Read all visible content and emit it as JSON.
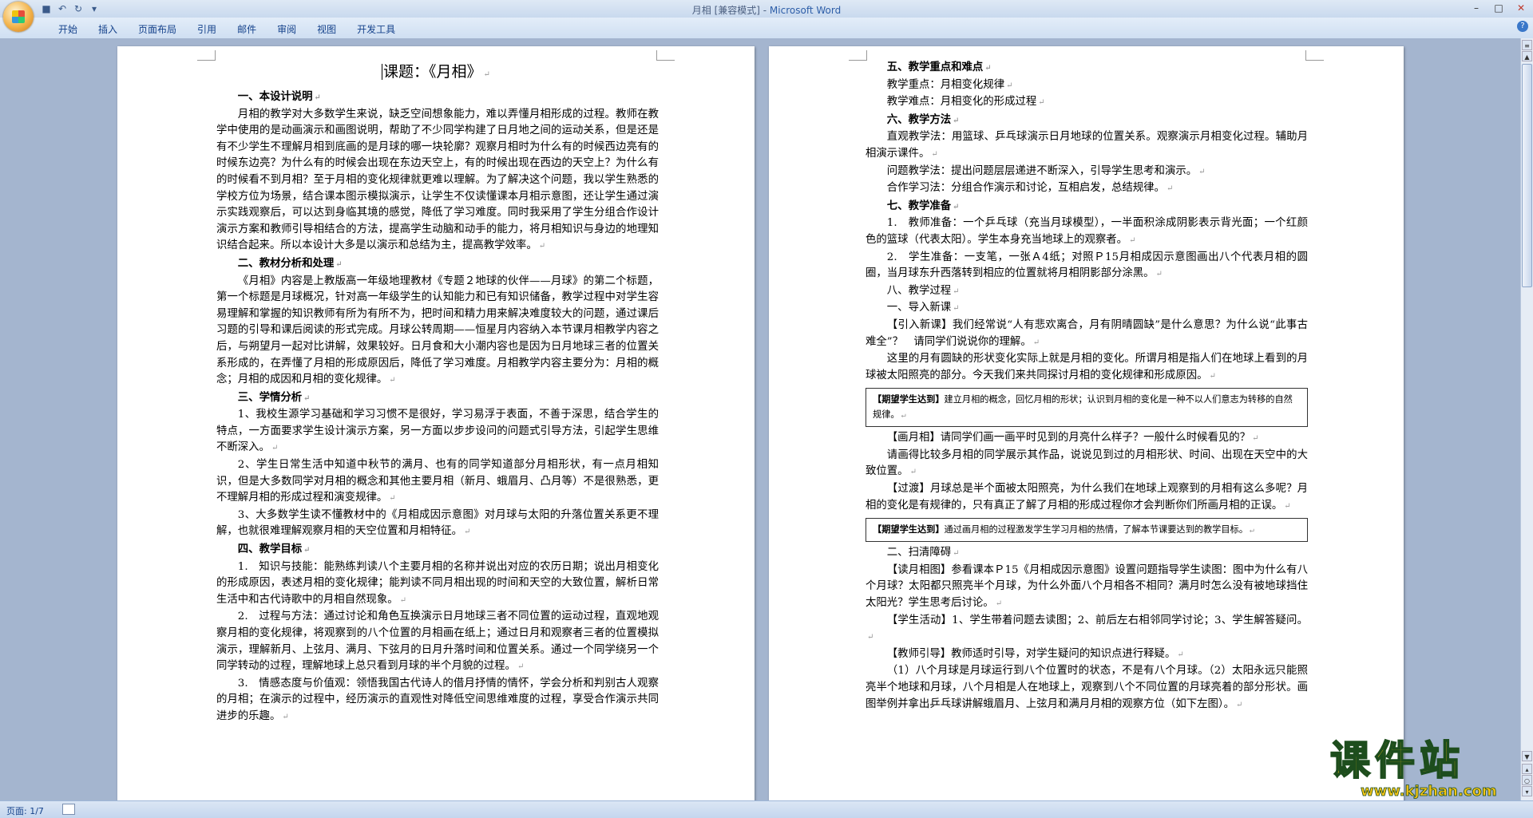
{
  "window": {
    "title_doc": "月相 [兼容模式] - ",
    "title_app": "Microsoft Word",
    "qat": [
      "save-icon",
      "undo-icon",
      "redo-icon",
      "customize-icon"
    ],
    "controls": [
      "–",
      "□",
      "✕"
    ]
  },
  "ribbon": {
    "tabs": [
      "开始",
      "插入",
      "页面布局",
      "引用",
      "邮件",
      "审阅",
      "视图",
      "开发工具"
    ],
    "help": "?"
  },
  "page1": {
    "title": "课题：《月相》",
    "s1_heading": "一、本设计说明",
    "s1_p1": "月相的教学对大多数学生来说，缺乏空间想象能力，难以弄懂月相形成的过程。教师在教学中使用的是动画演示和画图说明，帮助了不少同学构建了日月地之间的运动关系，但是还是有不少学生不理解月相到底画的是月球的哪一块轮廓？观察月相时为什么有的时候西边亮有的时候东边亮？为什么有的时候会出现在东边天空上，有的时候出现在西边的天空上？为什么有的时候看不到月相？至于月相的变化规律就更难以理解。为了解决这个问题，我以学生熟悉的学校方位为场景，结合课本图示模拟演示，让学生不仅读懂课本月相示意图，还让学生通过演示实践观察后，可以达到身临其境的感觉，降低了学习难度。同时我采用了学生分组合作设计演示方案和教师引导相结合的方法，提高学生动脑和动手的能力，将月相知识与身边的地理知识结合起来。所以本设计大多是以演示和总结为主，提高教学效率。",
    "s2_heading": "二、教材分析和处理",
    "s2_p1": "《月相》内容是上教版高一年级地理教材《专题２地球的伙伴——月球》的第二个标题，第一个标题是月球概况，针对高一年级学生的认知能力和已有知识储备，教学过程中对学生容易理解和掌握的知识教师有所为有所不为，把时间和精力用来解决难度较大的问题，通过课后习题的引导和课后阅读的形式完成。月球公转周期——恒星月内容纳入本节课月相教学内容之后，与朔望月一起对比讲解，效果较好。日月食和大小潮内容也是因为日月地球三者的位置关系形成的，在弄懂了月相的形成原因后，降低了学习难度。月相教学内容主要分为：月相的概念；月相的成因和月相的变化规律。",
    "s3_heading": "三、学情分析",
    "s3_p1": "1、我校生源学习基础和学习习惯不是很好，学习易浮于表面，不善于深思，结合学生的特点，一方面要求学生设计演示方案，另一方面以步步设问的问题式引导方法，引起学生思维不断深入。",
    "s3_p2": "2、学生日常生活中知道中秋节的满月、也有的同学知道部分月相形状，有一点月相知识，但是大多数同学对月相的概念和其他主要月相（新月、蛾眉月、凸月等）不是很熟悉，更不理解月相的形成过程和演变规律。",
    "s3_p3": "3、大多数学生读不懂教材中的《月相成因示意图》对月球与太阳的升落位置关系更不理解，也就很难理解观察月相的天空位置和月相特征。",
    "s4_heading": "四、教学目标",
    "s4_p1": "1.　知识与技能：能熟练判读八个主要月相的名称并说出对应的农历日期；说出月相变化的形成原因，表述月相的变化规律；能判读不同月相出现的时间和天空的大致位置，解析日常生活中和古代诗歌中的月相自然现象。",
    "s4_p2": "2.　过程与方法：通过讨论和角色互换演示日月地球三者不同位置的运动过程，直观地观察月相的变化规律，将观察到的八个位置的月相画在纸上；通过日月和观察者三者的位置模拟演示，理解新月、上弦月、满月、下弦月的日月升落时间和位置关系。通过一个同学绕另一个同学转动的过程，理解地球上总只看到月球的半个月貌的过程。",
    "s4_p3": "3.　情感态度与价值观：领悟我国古代诗人的借月抒情的情怀，学会分析和判别古人观察的月相；在演示的过程中，经历演示的直观性对降低空间思维难度的过程，享受合作演示共同进步的乐趣。"
  },
  "page2": {
    "s5_heading": "五、教学重点和难点",
    "s5_l1": "教学重点：月相变化规律",
    "s5_l2": "教学难点：月相变化的形成过程",
    "s6_heading": "六、教学方法",
    "s6_p1": "直观教学法：用篮球、乒乓球演示日月地球的位置关系。观察演示月相变化过程。辅助月相演示课件。",
    "s6_p2": "问题教学法：提出问题层层递进不断深入，引导学生思考和演示。",
    "s6_p3": "合作学习法：分组合作演示和讨论，互相启发，总结规律。",
    "s7_heading": "七、教学准备",
    "s7_p1": "1.　教师准备：一个乒乓球（充当月球模型），一半面积涂成阴影表示背光面；一个红颜色的篮球（代表太阳）。学生本身充当地球上的观察者。",
    "s7_p2": "2.　学生准备：一支笔，一张Ａ4纸；对照Ｐ15月相成因示意图画出八个代表月相的圆圈，当月球东升西落转到相应的位置就将月相阴影部分涂黑。",
    "s8_heading": "八、教学过程",
    "s8_sub1": "一、导入新课",
    "s8_p1": "【引入新课】我们经常说“人有悲欢离合，月有阴晴圆缺”是什么意思？为什么说“此事古难全”？　请同学们说说你的理解。",
    "s8_p2": "这里的月有圆缺的形状变化实际上就是月相的变化。所谓月相是指人们在地球上看到的月球被太阳照亮的部分。今天我们来共同探讨月相的变化规律和形成原因。",
    "box1_tag": "【期望学生达到】",
    "box1_text": "建立月相的概念，回忆月相的形状；认识到月相的变化是一种不以人们意志为转移的自然规律。",
    "s8_p3": "【画月相】请同学们画一画平时见到的月亮什么样子？一般什么时候看见的？",
    "s8_p4": "请画得比较多月相的同学展示其作品，说说见到过的月相形状、时间、出现在天空中的大致位置。",
    "s8_p5": "【过渡】月球总是半个面被太阳照亮，为什么我们在地球上观察到的月相有这么多呢？月相的变化是有规律的，只有真正了解了月相的形成过程你才会判断你们所画月相的正误。",
    "box2_tag": "【期望学生达到】",
    "box2_text": "通过画月相的过程激发学生学习月相的热情，了解本节课要达到的教学目标。",
    "s8_sub2": "二、扫清障碍",
    "s8_p6": "【读月相图】参看课本Ｐ15《月相成因示意图》设置问题指导学生读图：图中为什么有八个月球？太阳都只照亮半个月球，为什么外面八个月相各不相同？满月时怎么没有被地球挡住太阳光？学生思考后讨论。",
    "s8_p7": "【学生活动】1、学生带着问题去读图；2、前后左右相邻同学讨论；3、学生解答疑问。",
    "s8_p8": "【教师引导】教师适时引导，对学生疑问的知识点进行释疑。",
    "s8_p9": "（1）八个月球是月球运行到八个位置时的状态，不是有八个月球。（2）太阳永远只能照亮半个地球和月球，八个月相是人在地球上，观察到八个不同位置的月球亮着的部分形状。画图举例并拿出乒乓球讲解蛾眉月、上弦月和满月月相的观察方位（如下左图）。"
  },
  "status": {
    "pages": "页面: 1/7"
  },
  "watermark": {
    "main": "课件站",
    "url": "www.kjzhan.com"
  }
}
